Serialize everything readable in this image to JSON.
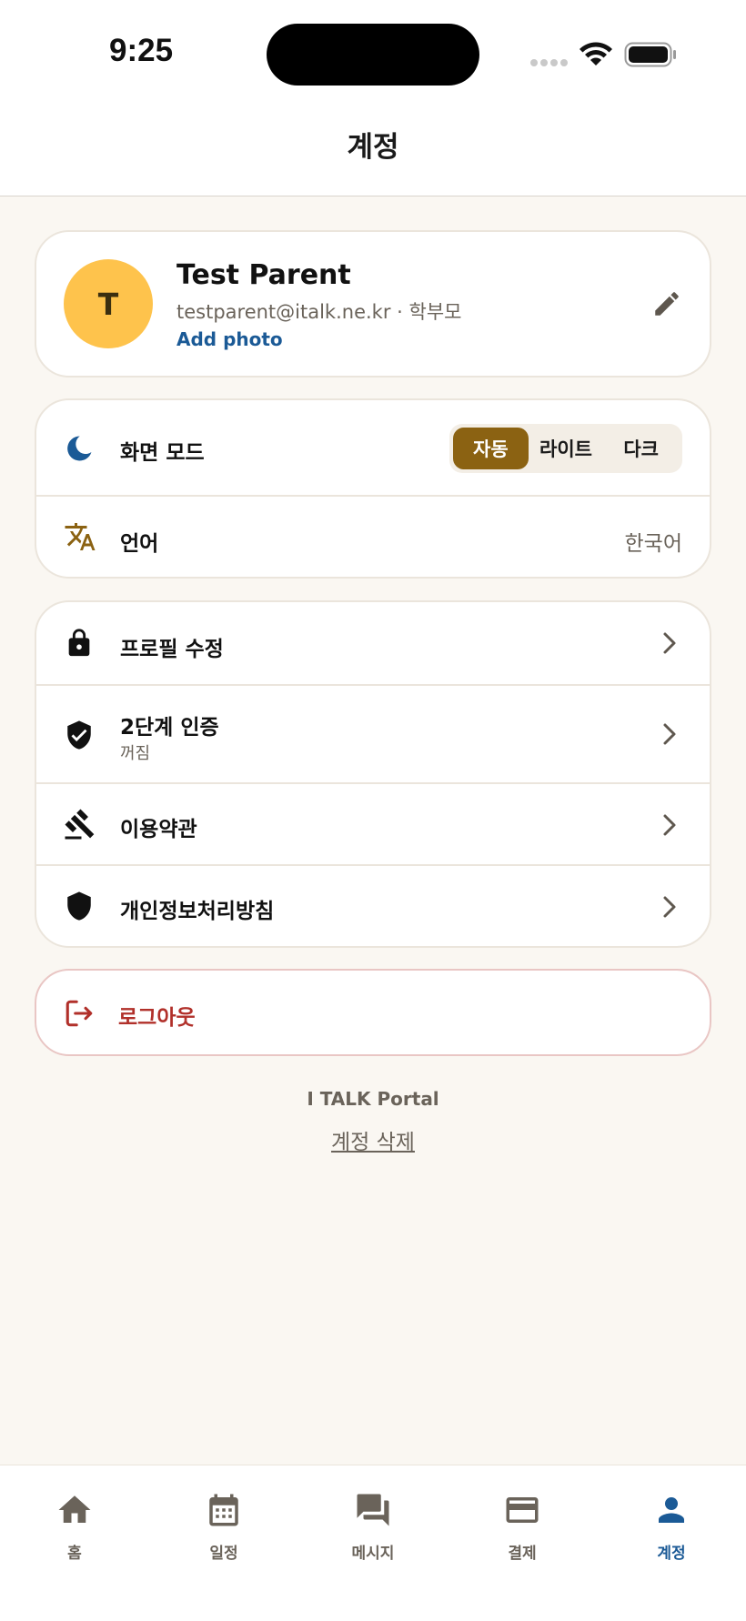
{
  "status_bar": {
    "time": "9:25"
  },
  "header": {
    "title": "계정"
  },
  "profile": {
    "initial": "T",
    "name": "Test Parent",
    "email_role": "testparent@italk.ne.kr · 학부모",
    "add_photo": "Add photo"
  },
  "settings": {
    "theme": {
      "label": "화면 모드",
      "options": [
        "자동",
        "라이트",
        "다크"
      ],
      "selected": "자동"
    },
    "language": {
      "label": "언어",
      "value": "한국어"
    }
  },
  "menu": {
    "edit_profile": "프로필 수정",
    "two_factor": {
      "label": "2단계 인증",
      "status": "꺼짐"
    },
    "terms": "이용약관",
    "privacy": "개인정보처리방침"
  },
  "logout": {
    "label": "로그아웃"
  },
  "footer": {
    "brand": "I TALK Portal",
    "delete_account": "계정 삭제"
  },
  "tabs": [
    {
      "label": "홈",
      "icon": "home-icon"
    },
    {
      "label": "일정",
      "icon": "calendar-icon"
    },
    {
      "label": "메시지",
      "icon": "chat-icon"
    },
    {
      "label": "결제",
      "icon": "credit-card-icon"
    },
    {
      "label": "계정",
      "icon": "person-icon",
      "active": true
    }
  ],
  "colors": {
    "accent": "#1b5a96",
    "brown": "#8b6212",
    "avatar": "#fec34c",
    "danger": "#b1302a",
    "background": "#faf7f2"
  }
}
